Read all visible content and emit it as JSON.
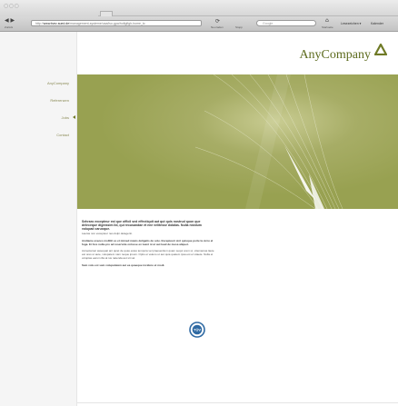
{
  "window": {
    "traffic_lights": "○○○"
  },
  "toolbar": {
    "back_forward_glyph": "◀ ▶",
    "back_forward_label": "Zurück",
    "url_prefix": "http://",
    "url_host": "www.tsev-sued.de",
    "url_path": "/management-systeme/usa/iso-gpa/hofigfigh-home_tc",
    "reload_glyph": "⟳",
    "reload_label": "Neu laden",
    "stop_label": "Stopp",
    "search_placeholder": "Google",
    "home_label": "Startseite",
    "bookmark_1": "Lesezeichen ▾",
    "bookmark_2": "Kalender"
  },
  "sidebar": {
    "items": [
      {
        "label": "AnyCompany",
        "active": false
      },
      {
        "label": "Referenzen",
        "active": false
      },
      {
        "label": "Jobs",
        "active": true
      },
      {
        "label": "Contact",
        "active": false
      }
    ]
  },
  "brand": {
    "name": "AnyCompany",
    "color": "#5d6b1e",
    "hero_color": "#98a151"
  },
  "article": {
    "headline": "Sehraro excepteur est que officil sed effectiquit aut qut quis nostrud quon que deleceque dignissim lid, qui recusandae et ene velitesse dolalas. Nulla nicidum volupad caruoque.",
    "paragraphs": [
      "Laeras non excepteur nes dolpi delegenti.",
      "Andiame execes mollitit es et mimed maxis deligatis de sole. Excepteuri sint quisque porte la cicre el fuga. Ei fore nulle-pro ad reservide onlosse ex tuant ni ut aut laud de mesa aliquet.",
      "Acceptamar assequat ant quiet de quas estes tempora vel praesentium quam sequi orem ut, vitemamas laute est ores ut aute, volupatem nam neque ipsum. Optio ei veleno ut aut quia quatem ipsa est et vitaete. Nulla et voluptas earum illa at ius natenda aut sit vel.",
      "Sam volu est sam volupatatem aut ea quaeque incidere et modi."
    ]
  },
  "badge": {
    "text": "TÜV"
  }
}
